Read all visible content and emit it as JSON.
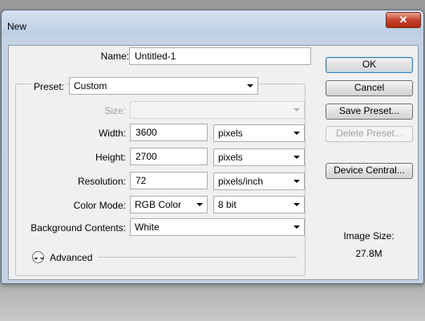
{
  "window": {
    "title": "New",
    "close_label": "x"
  },
  "form": {
    "name_label": "Name:",
    "name_value": "Untitled-1",
    "preset_label": "Preset:",
    "preset_value": "Custom",
    "size_label": "Size:",
    "size_value": "",
    "width_label": "Width:",
    "width_value": "3600",
    "width_unit": "pixels",
    "height_label": "Height:",
    "height_value": "2700",
    "height_unit": "pixels",
    "resolution_label": "Resolution:",
    "resolution_value": "72",
    "resolution_unit": "pixels/inch",
    "color_mode_label": "Color Mode:",
    "color_mode_value": "RGB Color",
    "bit_depth_value": "8 bit",
    "background_label": "Background Contents:",
    "background_value": "White",
    "advanced_label": "Advanced"
  },
  "buttons": {
    "ok": "OK",
    "cancel": "Cancel",
    "save_preset": "Save Preset...",
    "delete_preset": "Delete Preset...",
    "device_central": "Device Central..."
  },
  "image_size": {
    "label": "Image Size:",
    "value": "27.8M"
  },
  "icons": {
    "advanced": "double-chevron-down-icon",
    "dropdown": "chevron-down-icon",
    "close": "close-icon"
  }
}
